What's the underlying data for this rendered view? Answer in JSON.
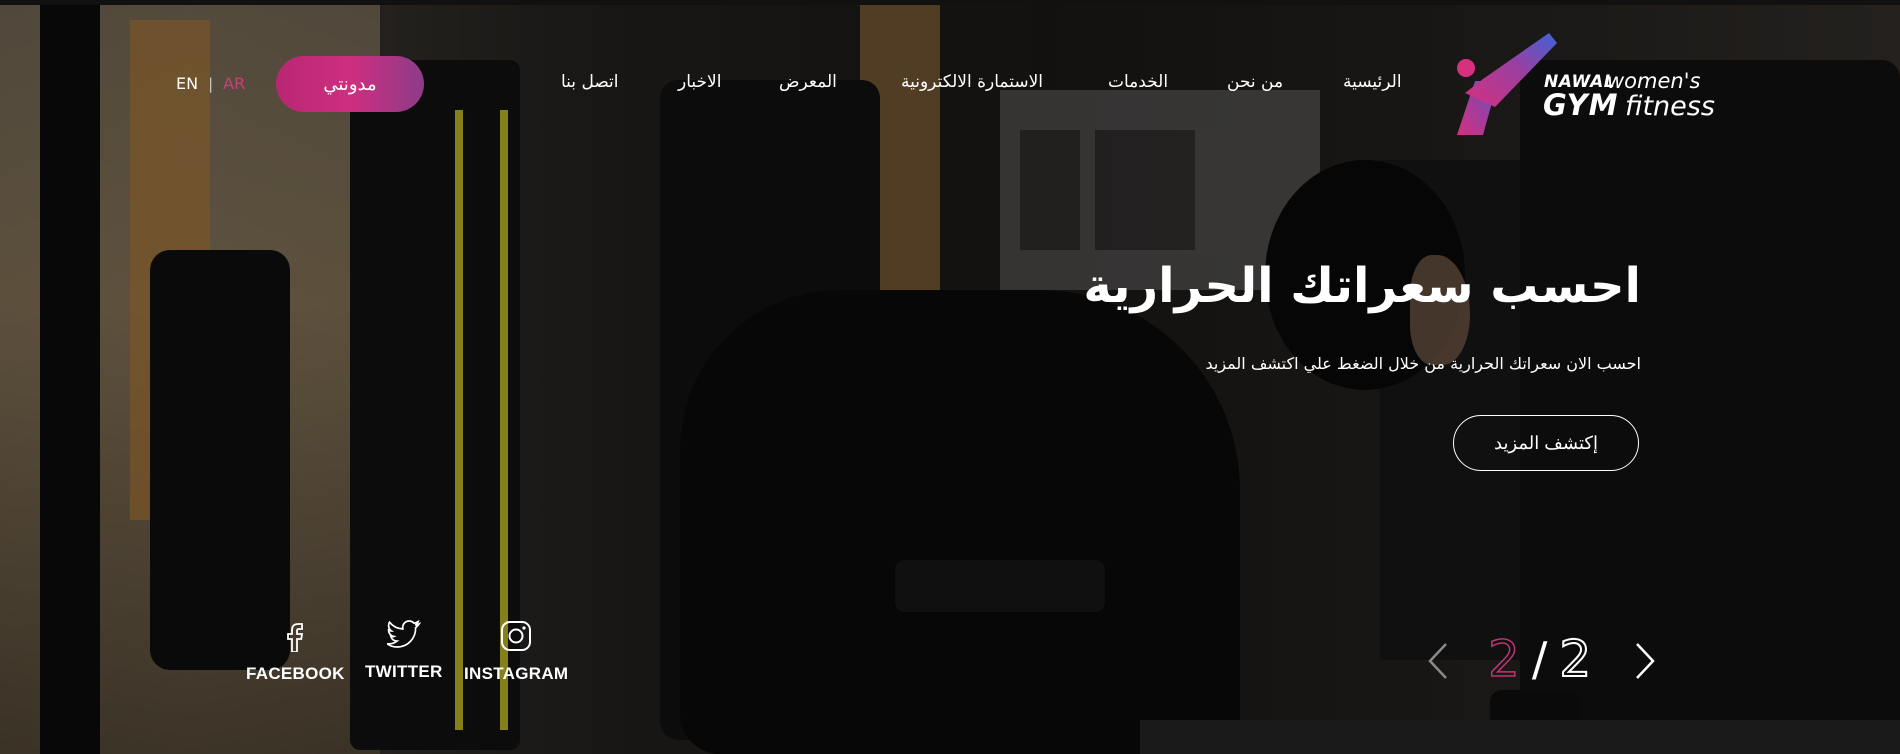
{
  "brand": {
    "name_line1": "NAWAL",
    "name_line2": "GYM",
    "tagline_line1": "women's",
    "tagline_line2": "fitness",
    "colors": {
      "accent": "#cf2e80",
      "accent_purple": "#8d3c88",
      "accent_blue": "#3b5fd6"
    }
  },
  "nav": {
    "items": [
      {
        "label": "الرئيسية"
      },
      {
        "label": "من نحن"
      },
      {
        "label": "الخدمات"
      },
      {
        "label": "الاستمارة الالكترونية"
      },
      {
        "label": "المعرض"
      },
      {
        "label": "الاخبار"
      },
      {
        "label": "اتصل بنا"
      }
    ],
    "blog_label": "مدونتي"
  },
  "language": {
    "en": "EN",
    "separator": "|",
    "ar": "AR",
    "active": "AR"
  },
  "hero": {
    "title": "احسب سعراتك الحرارية",
    "subtitle": "احسب الان سعراتك الحرارية من خلال الضغط علي اكتشف المزيد",
    "cta_label": "إكتشف المزيد"
  },
  "slider": {
    "current": "2",
    "separator": "/",
    "total": "2"
  },
  "social": {
    "facebook": {
      "label": "FACEBOOK",
      "icon": "facebook-icon"
    },
    "twitter": {
      "label": "TWITTER",
      "icon": "twitter-icon"
    },
    "instagram": {
      "label": "INSTAGRAM",
      "icon": "instagram-icon"
    }
  }
}
